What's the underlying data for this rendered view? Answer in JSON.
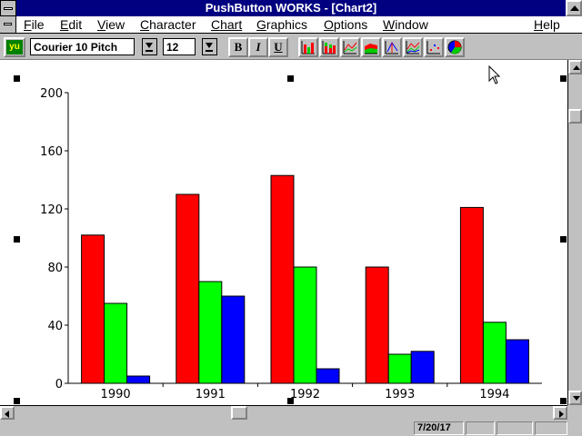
{
  "window": {
    "title": "PushButton WORKS - [Chart2]"
  },
  "menu": [
    {
      "label": "File",
      "u": "F",
      "rest": "ile"
    },
    {
      "label": "Edit",
      "u": "E",
      "rest": "dit"
    },
    {
      "label": "View",
      "u": "V",
      "rest": "iew"
    },
    {
      "label": "Character",
      "u": "C",
      "rest": "haracter"
    },
    {
      "label": "Chart",
      "u": "",
      "rest": "Chart"
    },
    {
      "label": "Graphics",
      "u": "G",
      "rest": "raphics"
    },
    {
      "label": "Options",
      "u": "O",
      "rest": "ptions"
    },
    {
      "label": "Window",
      "u": "W",
      "rest": "indow"
    },
    {
      "label": "Help",
      "u": "H",
      "rest": "elp"
    }
  ],
  "toolbar": {
    "app_icon_label": "yu",
    "font_name": "Courier 10 Pitch",
    "font_size": "12",
    "bold_label": "B",
    "italic_label": "I",
    "underline_label": "U",
    "chart_icons": [
      "bar-chart-icon",
      "stacked-bar-chart-icon",
      "line-chart-icon",
      "area-chart-icon",
      "hi-lo-chart-icon",
      "combo-chart-icon",
      "scatter-chart-icon",
      "pie-chart-icon"
    ]
  },
  "status": {
    "date": "7/20/17"
  },
  "colors": {
    "series1": "#ff0000",
    "series2": "#00ff00",
    "series3": "#0000ff",
    "titlebar": "#000080"
  },
  "chart_data": {
    "type": "bar",
    "categories": [
      "1990",
      "1991",
      "1992",
      "1993",
      "1994"
    ],
    "series": [
      {
        "values": [
          102,
          130,
          143,
          80,
          121
        ],
        "color": "#ff0000"
      },
      {
        "values": [
          55,
          70,
          80,
          20,
          42
        ],
        "color": "#00ff00"
      },
      {
        "values": [
          5,
          60,
          10,
          22,
          30
        ],
        "color": "#0000ff"
      }
    ],
    "yticks": [
      "0",
      "40",
      "80",
      "120",
      "160",
      "200"
    ],
    "ylim": [
      0,
      200
    ],
    "grid": false,
    "legend": "none"
  }
}
